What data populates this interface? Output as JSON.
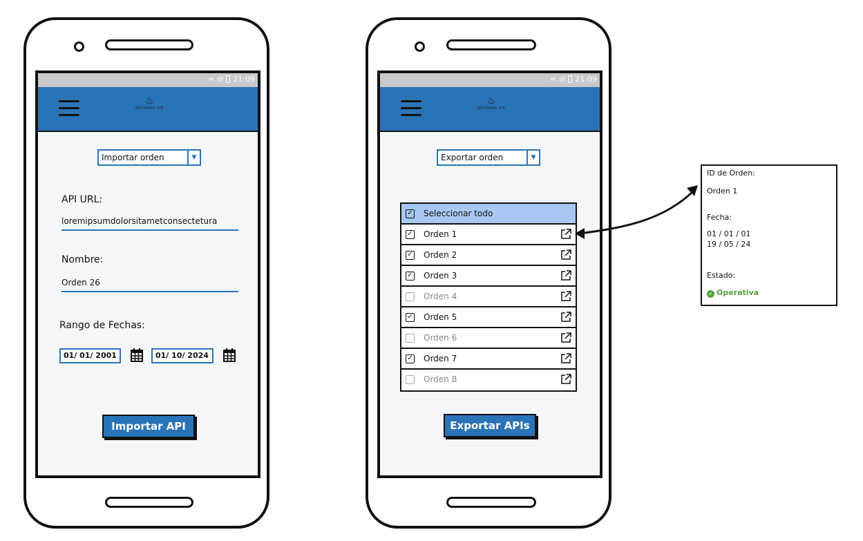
{
  "status_bar": {
    "time": "21:09"
  },
  "app": {
    "logo_text": "SISTEMAS LTE"
  },
  "import_screen": {
    "mode_select": "Importar orden",
    "api_url_label": "API URL:",
    "api_url_value": "loremipsumdolorsitametconsectetura",
    "name_label": "Nombre:",
    "name_value": "Orden 26",
    "date_range_label": "Rango de Fechas:",
    "date_from": "01/ 01/ 2001",
    "date_to": "01/ 10/ 2024",
    "import_button": "Importar API"
  },
  "export_screen": {
    "mode_select": "Exportar orden",
    "select_all": {
      "label": "Seleccionar todo",
      "checked": true
    },
    "orders": [
      {
        "label": "Orden 1",
        "checked": true
      },
      {
        "label": "Orden 2",
        "checked": true
      },
      {
        "label": "Orden 3",
        "checked": true
      },
      {
        "label": "Orden 4",
        "checked": false
      },
      {
        "label": "Orden 5",
        "checked": true
      },
      {
        "label": "Orden 6",
        "checked": false
      },
      {
        "label": "Orden 7",
        "checked": true
      },
      {
        "label": "Orden 8",
        "checked": false
      }
    ],
    "export_button": "Exportar APIs"
  },
  "detail_popup": {
    "id_label": "ID de Orden:",
    "id_value": "Orden 1",
    "date_label": "Fecha:",
    "date_line1": "01 / 01 / 01",
    "date_line2": "19 / 05 / 24",
    "state_label": "Estado:",
    "state_value": "Operativa"
  },
  "colors": {
    "primary": "#2a73b8",
    "header_row": "#a7c8f2",
    "ok": "#5aa13f"
  }
}
